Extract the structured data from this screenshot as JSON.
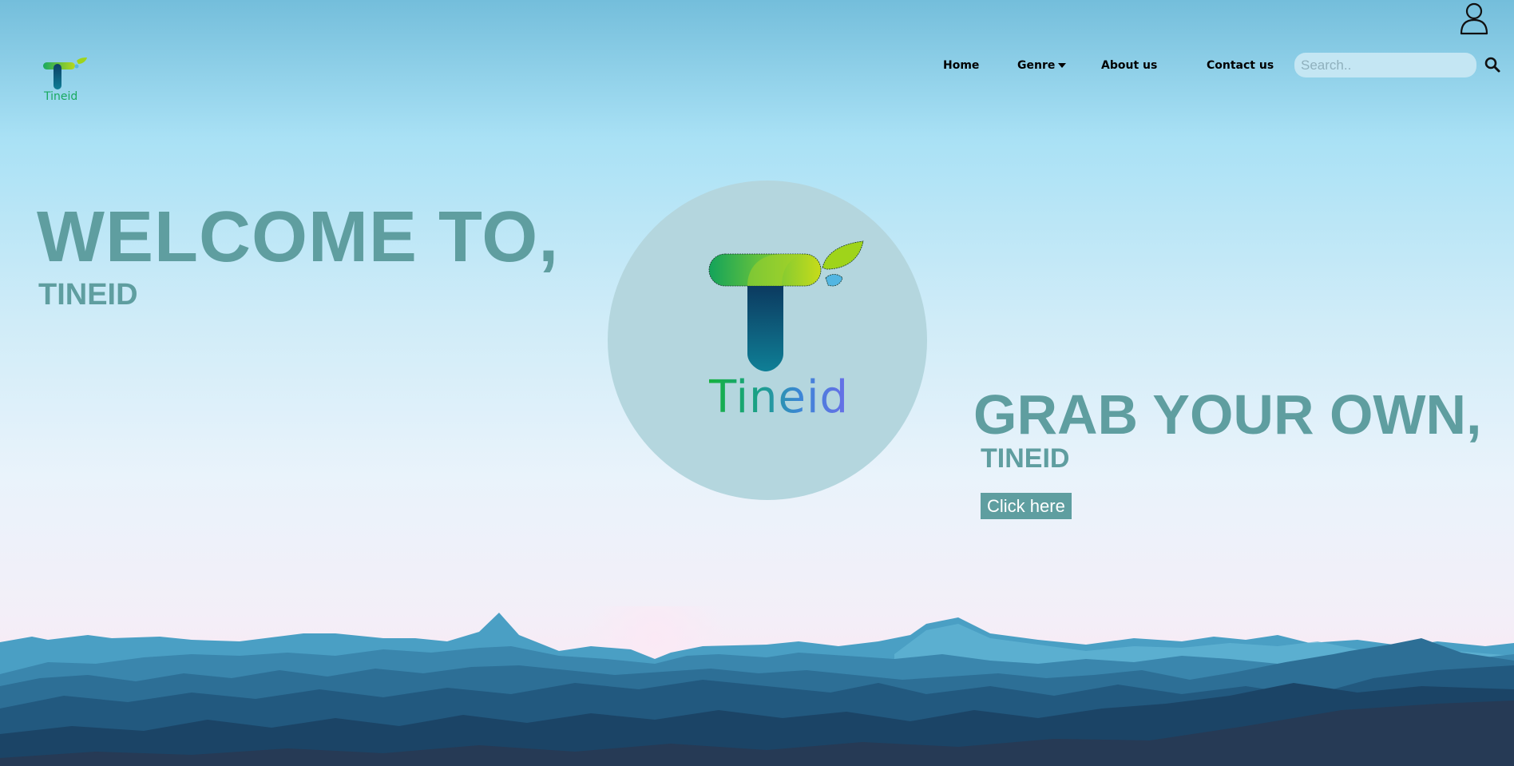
{
  "brand": {
    "name": "Tineid",
    "accent": "#5f9ea0"
  },
  "header": {
    "user_icon": "user-icon",
    "nav": [
      {
        "label": "Home"
      },
      {
        "label": "Genre",
        "icon": "caret-down-icon"
      },
      {
        "label": "About us"
      },
      {
        "label": "Contact us"
      }
    ],
    "search": {
      "placeholder": "Search..",
      "value": "",
      "icon": "search-icon"
    }
  },
  "hero": {
    "welcome_title": "WELCOME TO,",
    "welcome_subtitle": "TINEID",
    "grab_title": "GRAB YOUR OWN,",
    "grab_subtitle": "TINEID",
    "cta_label": "Click here"
  },
  "colors": {
    "heading": "#5f9ea0",
    "circle": "#b4d6de",
    "search_bg": "#c4e6f3",
    "cta_bg": "#5f9ea0"
  }
}
